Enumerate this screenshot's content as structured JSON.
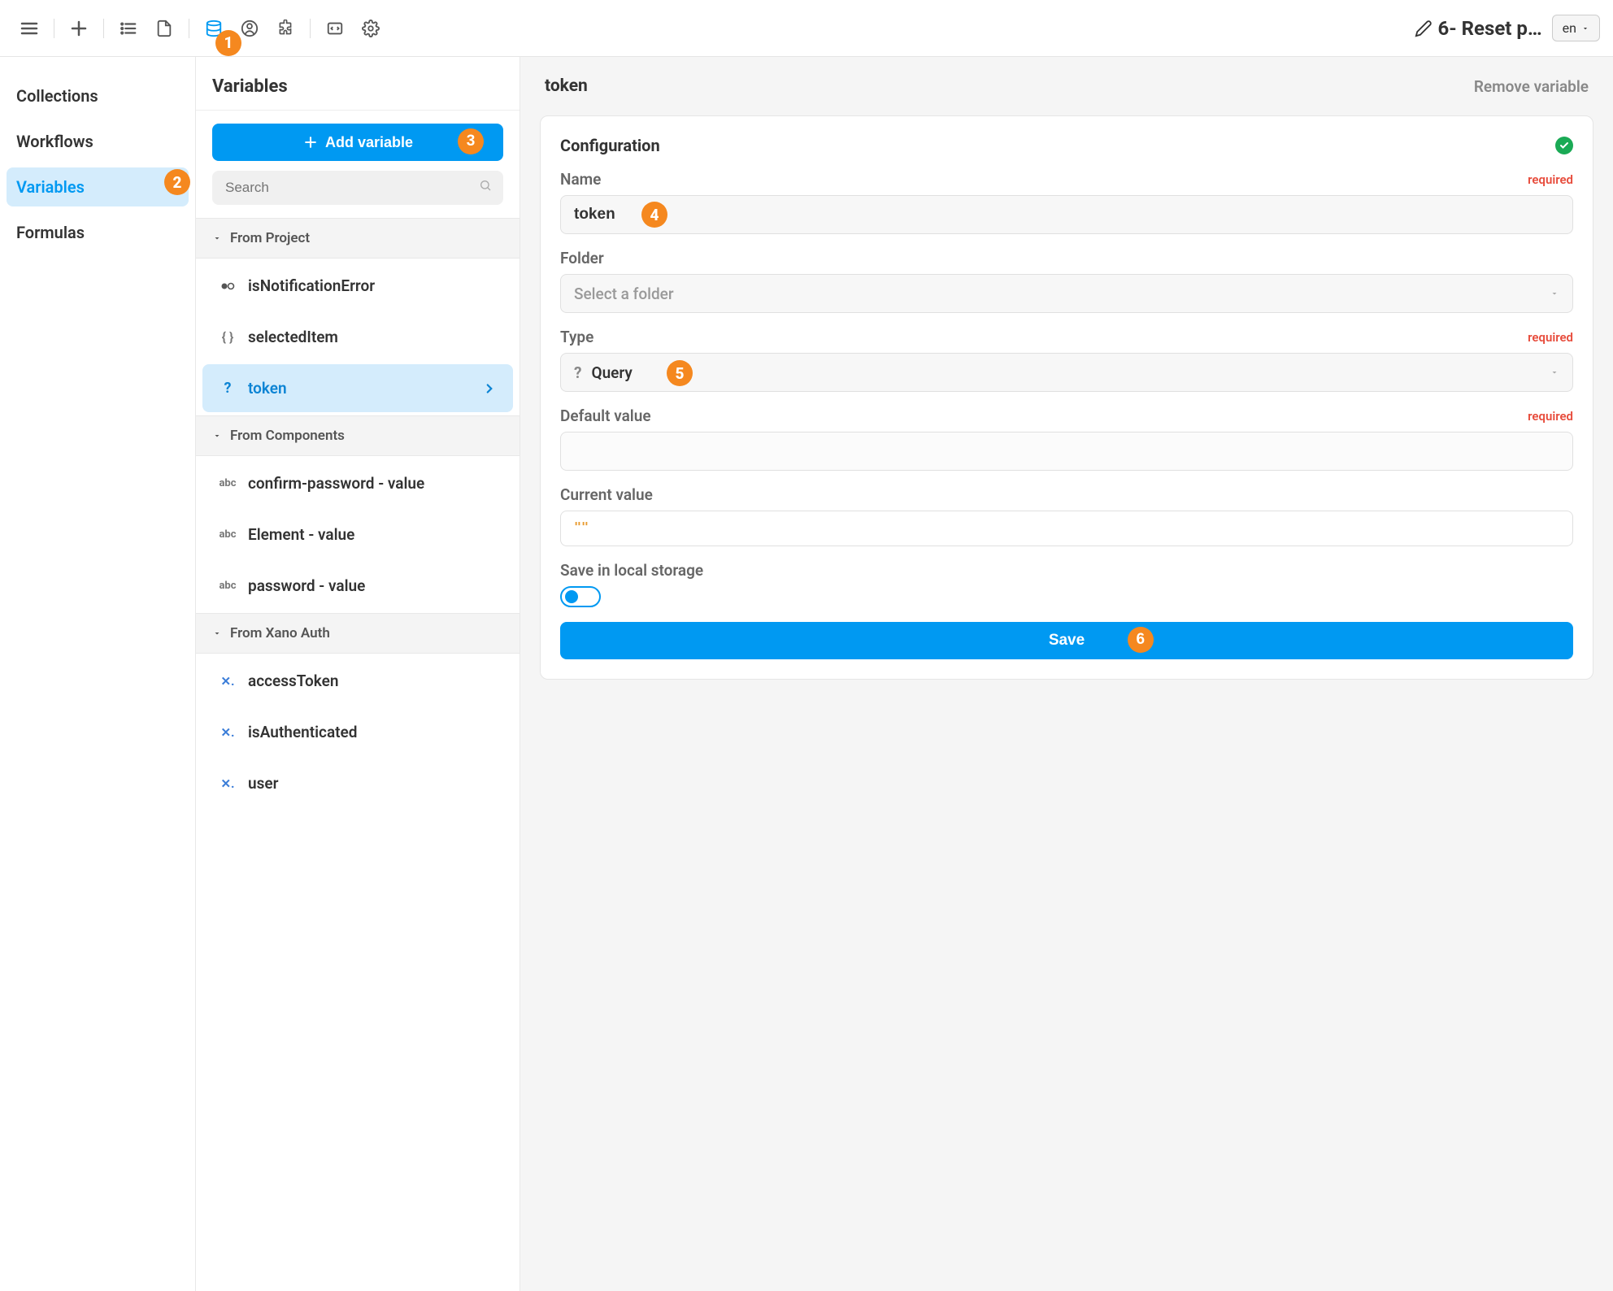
{
  "topbar": {
    "page_title": "6- Reset p…",
    "lang": "en"
  },
  "sidebar": {
    "items": [
      {
        "label": "Collections"
      },
      {
        "label": "Workflows"
      },
      {
        "label": "Variables"
      },
      {
        "label": "Formulas"
      }
    ]
  },
  "panel": {
    "title": "Variables",
    "add_label": "Add variable",
    "search_placeholder": "Search",
    "groups": [
      {
        "title": "From Project",
        "items": [
          {
            "icon": "bool",
            "label": "isNotificationError"
          },
          {
            "icon": "obj",
            "label": "selectedItem"
          },
          {
            "icon": "query",
            "label": "token"
          }
        ]
      },
      {
        "title": "From Components",
        "items": [
          {
            "icon": "abc",
            "label": "confirm-password - value"
          },
          {
            "icon": "abc",
            "label": "Element - value"
          },
          {
            "icon": "abc",
            "label": "password - value"
          }
        ]
      },
      {
        "title": "From Xano Auth",
        "items": [
          {
            "icon": "xano",
            "label": "accessToken"
          },
          {
            "icon": "xano",
            "label": "isAuthenticated"
          },
          {
            "icon": "xano",
            "label": "user"
          }
        ]
      }
    ]
  },
  "detail": {
    "title": "token",
    "remove_label": "Remove variable",
    "config_title": "Configuration",
    "name_label": "Name",
    "name_value": "token",
    "folder_label": "Folder",
    "folder_placeholder": "Select a folder",
    "type_label": "Type",
    "type_value": "Query",
    "default_label": "Default value",
    "current_label": "Current value",
    "current_value": "\"\"",
    "localstorage_label": "Save in local storage",
    "save_label": "Save",
    "required": "required"
  },
  "callouts": [
    "1",
    "2",
    "3",
    "4",
    "5",
    "6"
  ]
}
